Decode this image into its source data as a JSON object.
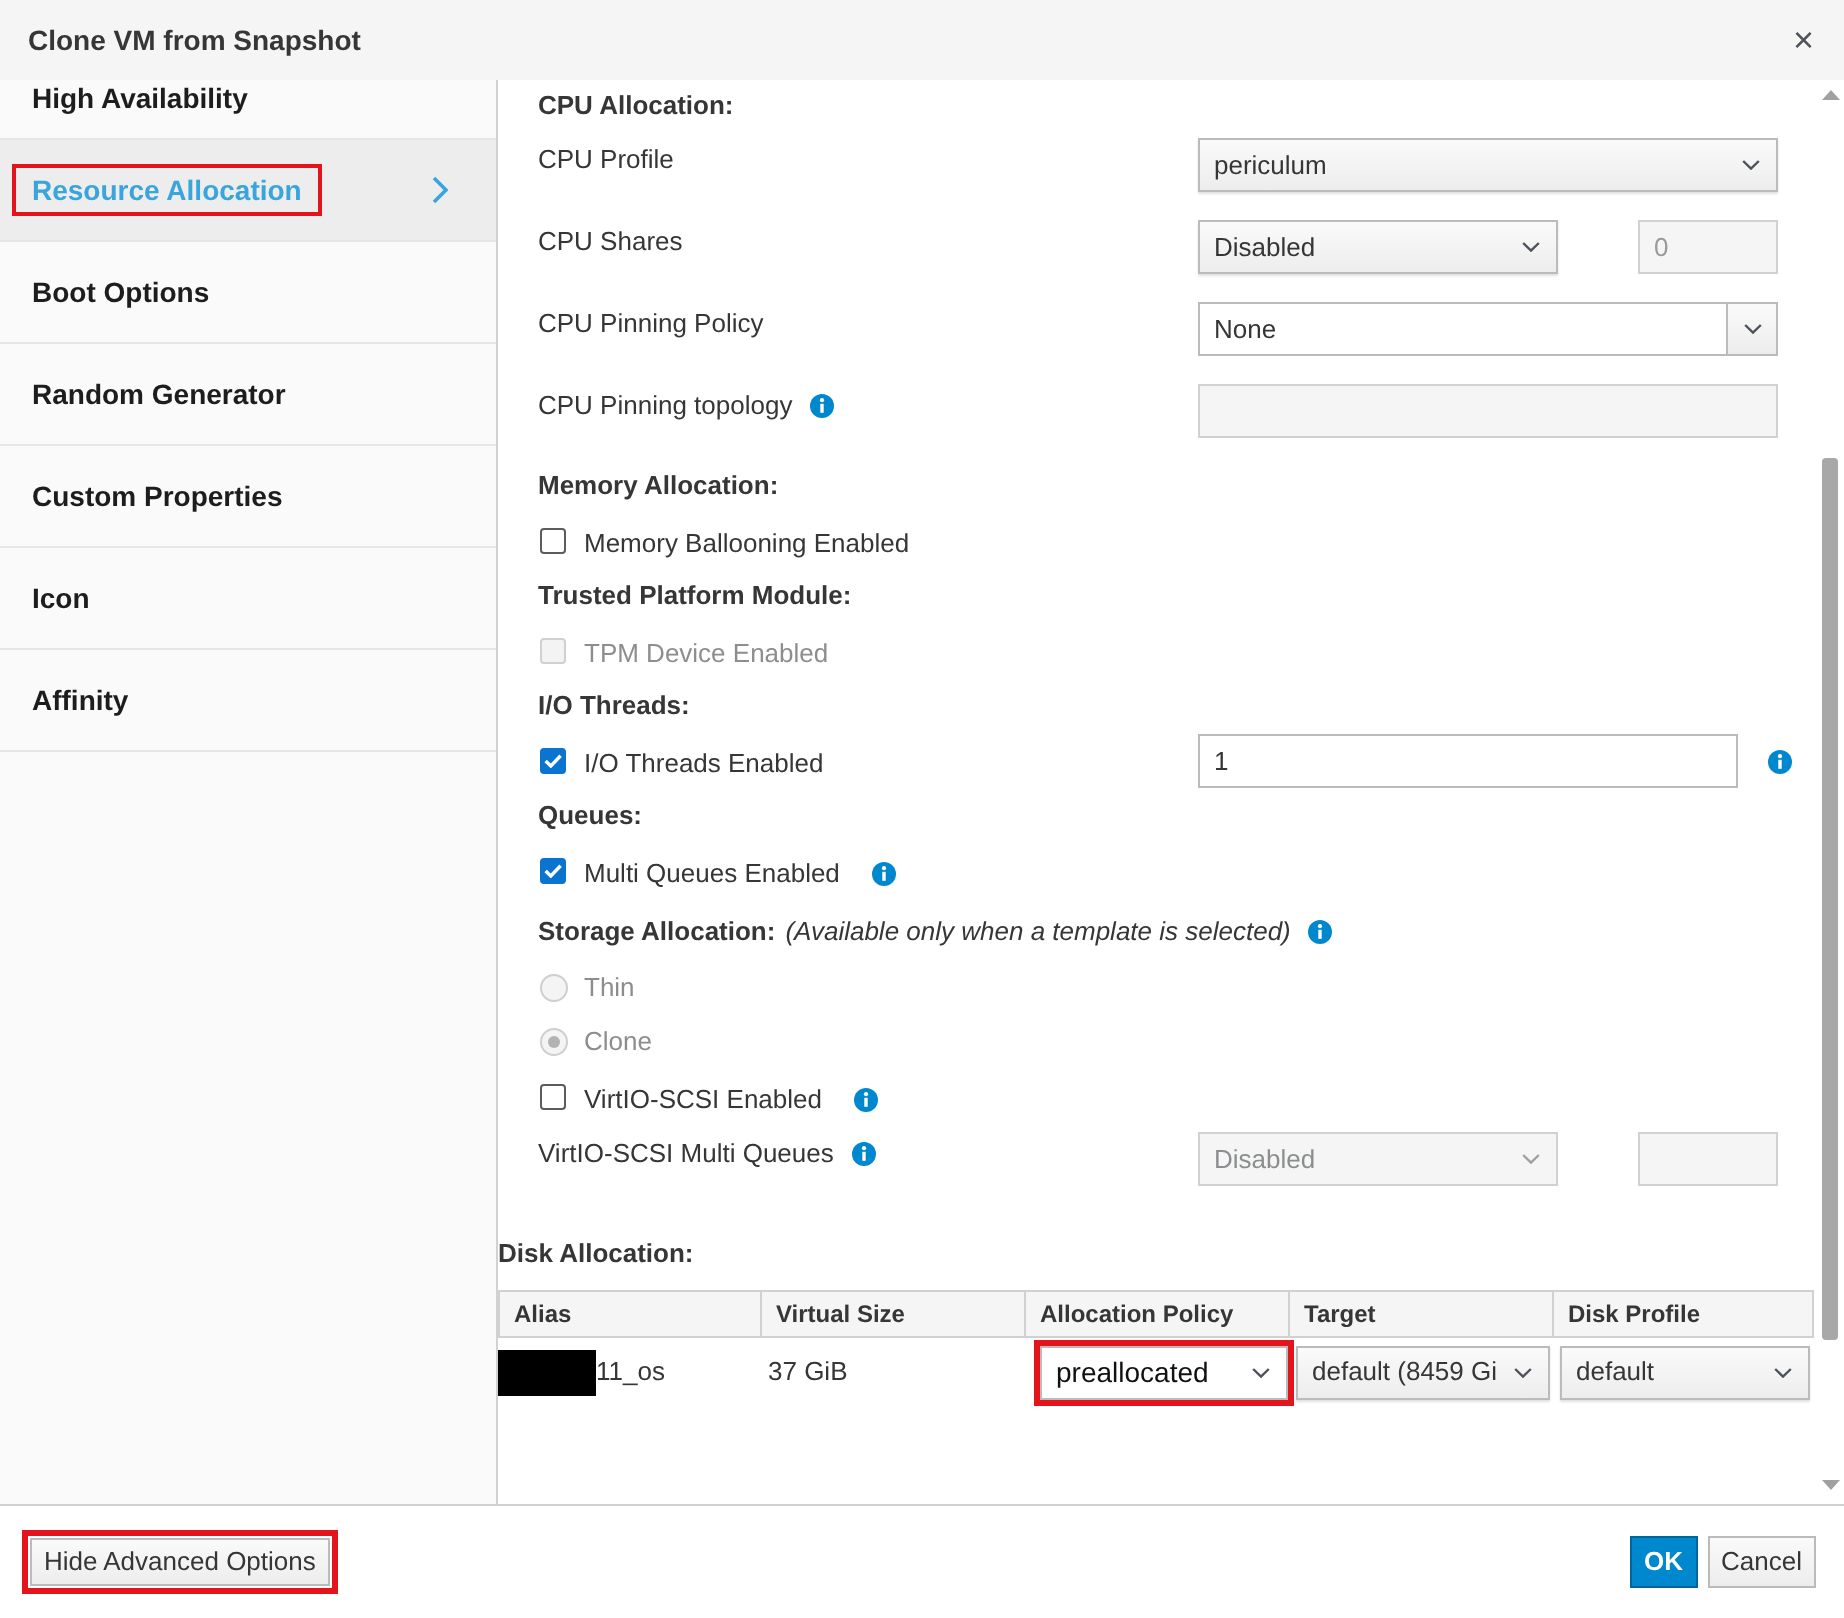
{
  "window": {
    "title": "Clone VM from Snapshot",
    "close": "×"
  },
  "sidebar": {
    "items": [
      {
        "label": "High Availability",
        "selected": false,
        "highlighted": false
      },
      {
        "label": "Resource Allocation",
        "selected": true,
        "highlighted": true
      },
      {
        "label": "Boot Options",
        "selected": false,
        "highlighted": false
      },
      {
        "label": "Random Generator",
        "selected": false,
        "highlighted": false
      },
      {
        "label": "Custom Properties",
        "selected": false,
        "highlighted": false
      },
      {
        "label": "Icon",
        "selected": false,
        "highlighted": false
      },
      {
        "label": "Affinity",
        "selected": false,
        "highlighted": false
      }
    ]
  },
  "sections": [
    {
      "heading": "CPU Allocation:",
      "rows": [
        {
          "kind": "select",
          "label": "CPU Profile",
          "value": "periculum",
          "disabled": false
        },
        {
          "kind": "select",
          "label": "CPU Shares",
          "value": "Disabled",
          "disabled": false,
          "extra": {
            "value": "0",
            "disabled": true
          }
        },
        {
          "kind": "combo",
          "label": "CPU Pinning Policy",
          "value": "None"
        },
        {
          "kind": "text",
          "label": "CPU Pinning topology",
          "disabled": true,
          "info": true
        }
      ]
    },
    {
      "heading": "Memory Allocation:",
      "rows": [
        {
          "kind": "checkbox",
          "label": "Memory Ballooning Enabled",
          "checked": false,
          "disabled": false
        }
      ]
    },
    {
      "heading": "Trusted Platform Module:",
      "rows": [
        {
          "kind": "checkbox",
          "label": "TPM Device Enabled",
          "checked": false,
          "disabled": true
        }
      ]
    },
    {
      "heading": "I/O Threads:",
      "rows": [
        {
          "kind": "checkbox",
          "label": "I/O Threads Enabled",
          "checked": true,
          "disabled": false,
          "input": {
            "value": "1",
            "info": true
          }
        }
      ]
    },
    {
      "heading": "Queues:",
      "rows": [
        {
          "kind": "checkbox",
          "label": "Multi Queues Enabled",
          "checked": true,
          "disabled": false,
          "info": true
        }
      ]
    },
    {
      "heading": "Storage Allocation:",
      "note": "(Available only when a template is selected)",
      "info": true,
      "rows": [
        {
          "kind": "radio",
          "label": "Thin",
          "selected": false,
          "disabled": true
        },
        {
          "kind": "radio",
          "label": "Clone",
          "selected": true,
          "disabled": true
        },
        {
          "kind": "checkbox",
          "label": "VirtIO-SCSI Enabled",
          "checked": false,
          "disabled": false,
          "info": true
        },
        {
          "kind": "select",
          "label": "VirtIO-SCSI Multi Queues",
          "value": "Disabled",
          "disabled": true,
          "info": true,
          "extra": {
            "disabled": true
          }
        }
      ]
    }
  ],
  "disk_allocation": {
    "heading": "Disk Allocation:",
    "columns": [
      "Alias",
      "Virtual Size",
      "Allocation Policy",
      "Target",
      "Disk Profile"
    ],
    "rows": [
      {
        "cells": [
          {
            "kind": "text",
            "text": "11_os",
            "redacted": true
          },
          {
            "kind": "text",
            "text": "37 GiB",
            "redacted": false
          },
          {
            "kind": "select",
            "value": "preallocated",
            "highlighted": true
          },
          {
            "kind": "select",
            "value": "default (8459 Gi",
            "highlighted": false
          },
          {
            "kind": "select",
            "value": "default",
            "highlighted": false
          }
        ]
      }
    ]
  },
  "footer": {
    "left": [
      {
        "label": "Hide Advanced Options",
        "kind": "secondary",
        "highlighted": true
      }
    ],
    "right": [
      {
        "label": "OK",
        "kind": "primary",
        "highlighted": false
      },
      {
        "label": "Cancel",
        "kind": "secondary",
        "highlighted": false
      }
    ]
  }
}
